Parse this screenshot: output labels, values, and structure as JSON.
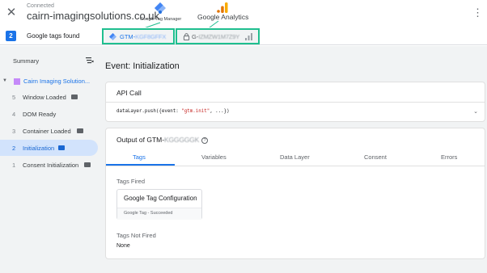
{
  "header": {
    "close_icon": "close-icon",
    "status": "Connected",
    "domain": "cairn-imagingsolutions.co.uk",
    "menu_icon": "more-vert-icon",
    "gtm_logo_label": "Google Tag Manager",
    "ga_logo_label": "Google Analytics"
  },
  "tagsbar": {
    "count": "2",
    "label": "Google tags found",
    "gtm_prefix": "GTM-",
    "gtm_id_obscured": "KGF8GFFX",
    "ga_prefix": "G-",
    "ga_id_obscured": "IZMZW1M7Z9Y",
    "highlight_color": "#1fbf8f"
  },
  "sidebar": {
    "summary_label": "Summary",
    "site_label": "Cairn Imaging Solution...",
    "events": [
      {
        "num": "5",
        "label": "Window Loaded",
        "api": true
      },
      {
        "num": "4",
        "label": "DOM Ready",
        "api": false
      },
      {
        "num": "3",
        "label": "Container Loaded",
        "api": true
      },
      {
        "num": "2",
        "label": "Initialization",
        "api": true
      },
      {
        "num": "1",
        "label": "Consent Initialization",
        "api": true
      }
    ],
    "active_event_index": 3
  },
  "main": {
    "event_title": "Event: Initialization",
    "api_call": {
      "title": "API Call",
      "code_prefix": "dataLayer.push({event: ",
      "code_string": "\"gtm.init\"",
      "code_suffix": ", ...})"
    },
    "output": {
      "title_prefix": "Output of GTM-",
      "title_id_obscured": "KGGGGGK",
      "tabs": [
        "Tags",
        "Variables",
        "Data Layer",
        "Consent",
        "Errors"
      ],
      "active_tab": "Tags",
      "tags_fired_label": "Tags Fired",
      "fired_tag": {
        "name": "Google Tag Configuration",
        "status": "Google Tag - Succeeded"
      },
      "tags_not_fired_label": "Tags Not Fired",
      "not_fired_value": "None"
    }
  },
  "colors": {
    "accent": "#1a73e8",
    "highlight": "#1fbf8f",
    "site_marker": "#c58af9"
  }
}
